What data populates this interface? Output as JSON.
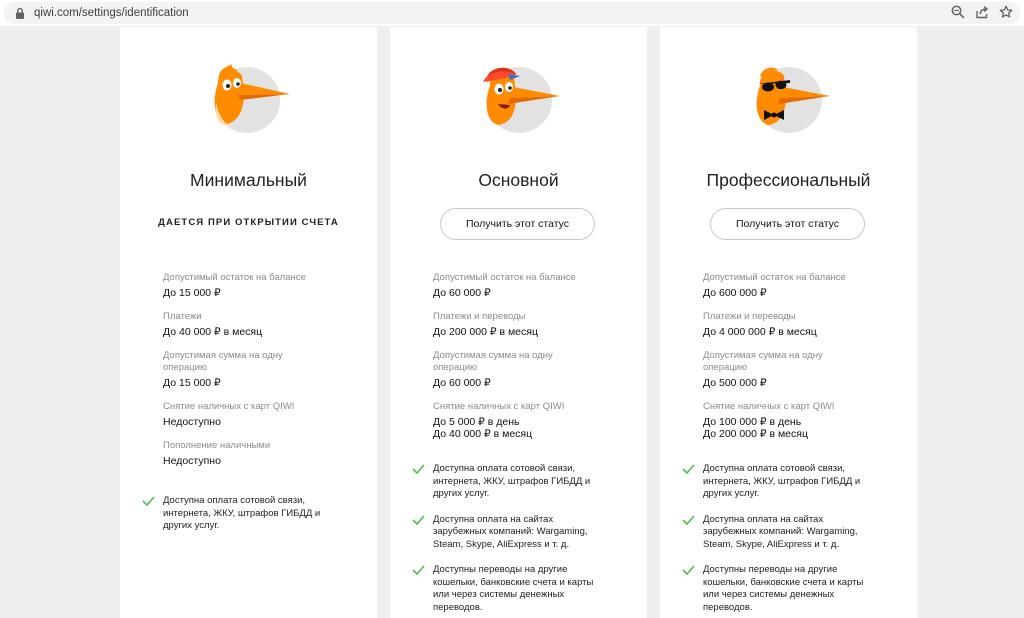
{
  "browser": {
    "url": "qiwi.com/settings/identification",
    "icons": [
      "lock-icon",
      "zoom-icon",
      "share-icon",
      "bookmark-star-icon"
    ]
  },
  "colors": {
    "accent_orange": "#ff8c00",
    "check_green": "#4bbf4b",
    "page_bg": "#eeeff1"
  },
  "tiers": [
    {
      "title": "Минимальный",
      "mascot": "bird-plain",
      "granted_text": "ДАЕТСЯ ПРИ ОТКРЫТИИ СЧЕТА",
      "limits": [
        {
          "label": "Допустимый остаток на балансе",
          "value": "До 15 000 ₽"
        },
        {
          "label": "Платежи",
          "value": "До 40 000 ₽ в месяц"
        },
        {
          "label": "Допустимая сумма на одну операцию",
          "value": "До 15 000 ₽"
        },
        {
          "label": "Снятие наличных с карт QIWI",
          "value": "Недоступно"
        },
        {
          "label": "Пополнение наличными",
          "value": "Недоступно"
        }
      ],
      "features": [
        "Доступна оплата сотовой связи, интернета, ЖКУ, штрафов ГИБДД и других услуг."
      ]
    },
    {
      "title": "Основной",
      "mascot": "bird-cap",
      "button_label": "Получить этот статус",
      "limits": [
        {
          "label": "Допустимый остаток на балансе",
          "value": "До 60 000 ₽"
        },
        {
          "label": "Платежи и переводы",
          "value": "До 200 000 ₽ в месяц"
        },
        {
          "label": "Допустимая сумма на одну операцию",
          "value": "До 60 000 ₽"
        },
        {
          "label": "Снятие наличных с карт QIWI",
          "value": "До 5 000 ₽ в день",
          "value2": "До 40 000 ₽ в месяц"
        }
      ],
      "features": [
        "Доступна оплата сотовой связи, интернета, ЖКУ, штрафов ГИБДД и других услуг.",
        "Доступна оплата на сайтах зарубежных компаний: Wargaming, Steam, Skype, AliExpress и т. д.",
        "Доступны переводы на другие кошельки, банковские счета и карты или через системы денежных переводов."
      ]
    },
    {
      "title": "Профессиональный",
      "mascot": "bird-sunglasses",
      "button_label": "Получить этот статус",
      "limits": [
        {
          "label": "Допустимый остаток на балансе",
          "value": "До 600 000 ₽"
        },
        {
          "label": "Платежи и переводы",
          "value": "До 4 000 000 ₽ в месяц"
        },
        {
          "label": "Допустимая сумма на одну операцию",
          "value": "До 500 000 ₽"
        },
        {
          "label": "Снятие наличных с карт QIWI",
          "value": "До 100 000 ₽ в день",
          "value2": "До 200 000 ₽ в месяц"
        }
      ],
      "features": [
        "Доступна оплата сотовой связи, интернета, ЖКУ, штрафов ГИБДД и других услуг.",
        "Доступна оплата на сайтах зарубежных компаний: Wargaming, Steam, Skype, AliExpress и т. д.",
        "Доступны переводы на другие кошельки, банковские счета и карты или через системы денежных переводов."
      ]
    }
  ]
}
